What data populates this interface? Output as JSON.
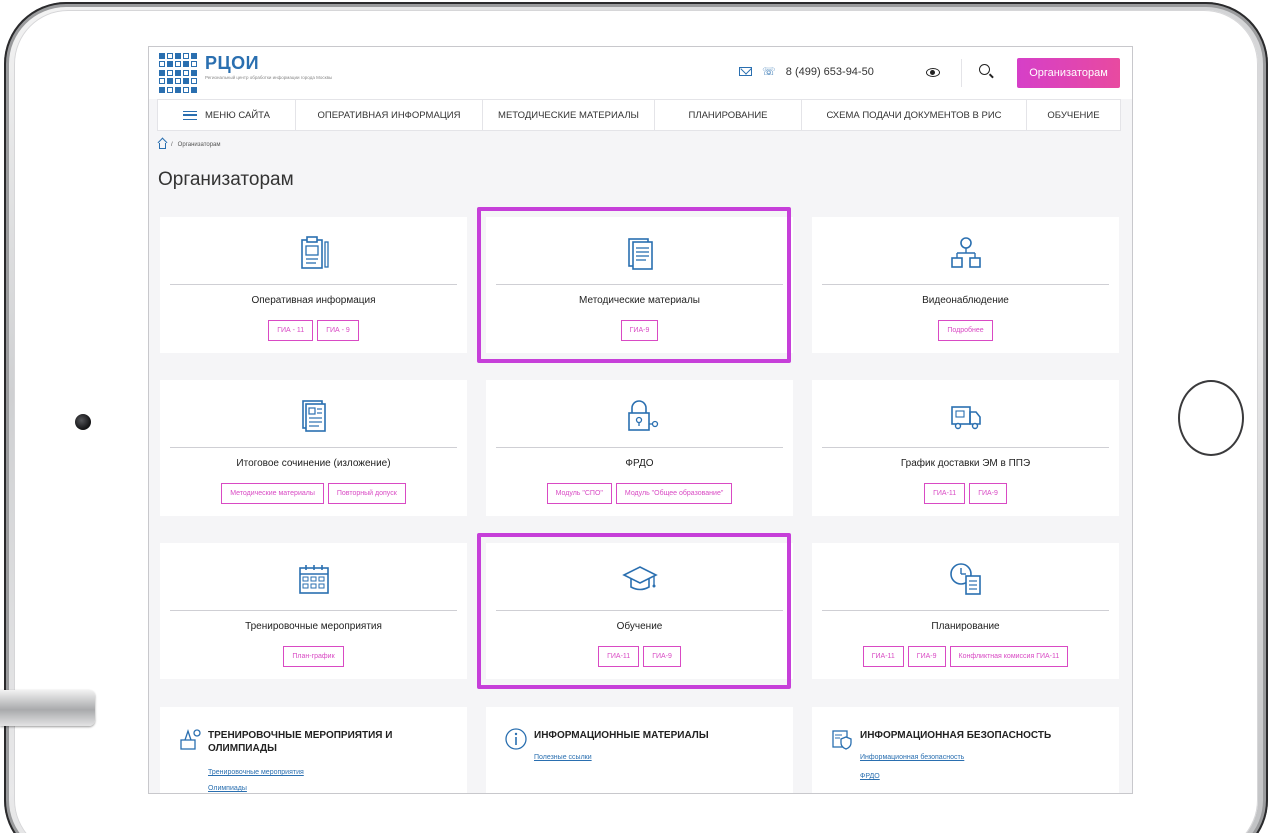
{
  "header": {
    "logo_title": "РЦОИ",
    "logo_subtitle": "Региональный центр обработки информации города Москвы",
    "phone": "8 (499) 653-94-50",
    "organizers_button": "Организаторам"
  },
  "nav": {
    "items": [
      {
        "label": "МЕНЮ САЙТА"
      },
      {
        "label": "ОПЕРАТИВНАЯ ИНФОРМАЦИЯ"
      },
      {
        "label": "МЕТОДИЧЕСКИЕ МАТЕРИАЛЫ"
      },
      {
        "label": "ПЛАНИРОВАНИЕ"
      },
      {
        "label": "СХЕМА ПОДАЧИ ДОКУМЕНТОВ В РИС"
      },
      {
        "label": "ОБУЧЕНИЕ"
      }
    ]
  },
  "breadcrumb": {
    "separator": "/",
    "current": "Организаторам"
  },
  "page": {
    "title": "Организаторам"
  },
  "cards": [
    {
      "title": "Оперативная информация",
      "icon": "clipboard-icon",
      "tags": [
        "ГИА - 11",
        "ГИА - 9"
      ]
    },
    {
      "title": "Методические материалы",
      "icon": "documents-icon",
      "tags": [
        "ГИА-9"
      ]
    },
    {
      "title": "Видеонаблюдение",
      "icon": "hierarchy-icon",
      "tags": [
        "Подробнее"
      ]
    },
    {
      "title": "Итоговое сочинение (изложение)",
      "icon": "essay-icon",
      "tags": [
        "Методические материалы",
        "Повторный допуск"
      ]
    },
    {
      "title": "ФРДО",
      "icon": "lock-key-icon",
      "tags": [
        "Модуль \"СПО\"",
        "Модуль \"Общее образование\""
      ]
    },
    {
      "title": "График доставки ЭМ в ППЭ",
      "icon": "truck-icon",
      "tags": [
        "ГИА-11",
        "ГИА-9"
      ]
    },
    {
      "title": "Тренировочные мероприятия",
      "icon": "calendar-icon",
      "tags": [
        "План-график"
      ]
    },
    {
      "title": "Обучение",
      "icon": "graduation-cap-icon",
      "tags": [
        "ГИА-11",
        "ГИА-9"
      ]
    },
    {
      "title": "Планирование",
      "icon": "planning-icon",
      "tags": [
        "ГИА-11",
        "ГИА-9",
        "Конфликтная комиссия ГИА-11"
      ]
    }
  ],
  "bottom_cards": [
    {
      "title": "ТРЕНИРОВОЧНЫЕ МЕРОПРИЯТИЯ И ОЛИМПИАДЫ",
      "icon": "award-icon",
      "links": [
        "Тренировочные мероприятия",
        "Олимпиады"
      ]
    },
    {
      "title": "ИНФОРМАЦИОННЫЕ МАТЕРИАЛЫ",
      "icon": "info-icon",
      "links": [
        "Полезные ссылки"
      ]
    },
    {
      "title": "ИНФОРМАЦИОННАЯ БЕЗОПАСНОСТЬ",
      "icon": "security-icon",
      "links": [
        "Информационная безопасность",
        "ФРДО"
      ]
    }
  ],
  "colors": {
    "accent": "#2a6fb0",
    "magenta": "#d94ac4",
    "highlight": "#c63fd9"
  }
}
